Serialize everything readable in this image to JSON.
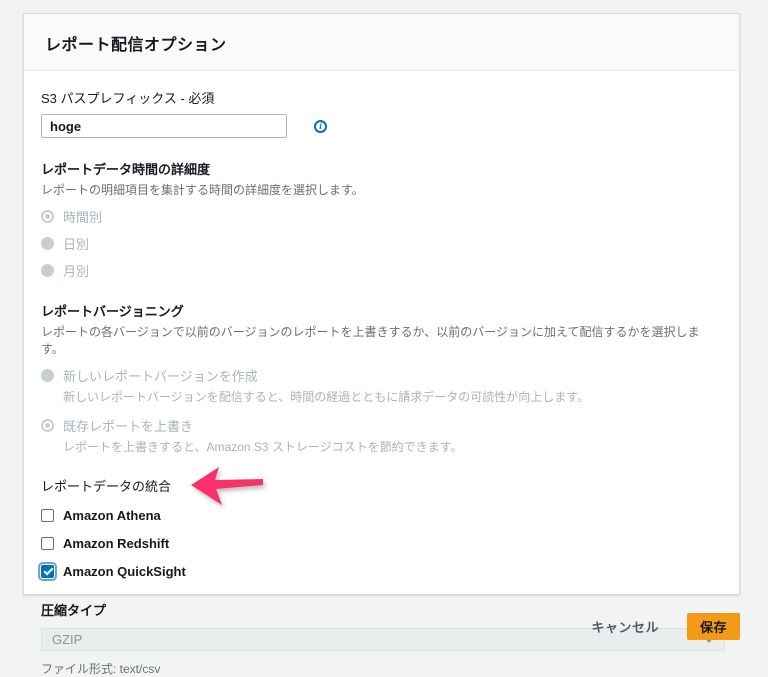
{
  "panel": {
    "title": "レポート配信オプション",
    "s3_prefix": {
      "label": "S3 パスプレフィックス - 必須",
      "value": "hoge",
      "info_icon_glyph": "i"
    },
    "granularity": {
      "label": "レポートデータ時間の詳細度",
      "description": "レポートの明細項目を集計する時間の詳細度を選択します。",
      "options": [
        {
          "label": "時間別",
          "selected": true,
          "disabled": true
        },
        {
          "label": "日別",
          "selected": false,
          "disabled": true
        },
        {
          "label": "月別",
          "selected": false,
          "disabled": true
        }
      ]
    },
    "versioning": {
      "label": "レポートバージョニング",
      "description": "レポートの各バージョンで以前のバージョンのレポートを上書きするか、以前のバージョンに加えて配信するかを選択します。",
      "options": [
        {
          "label": "新しいレポートバージョンを作成",
          "description": "新しいレポートバージョンを配信すると、時間の経過とともに請求データの可読性が向上します。",
          "selected": false,
          "disabled": true
        },
        {
          "label": "既存レポートを上書き",
          "description": "レポートを上書きすると、Amazon S3 ストレージコストを節約できます。",
          "selected": true,
          "disabled": true
        }
      ]
    },
    "integration": {
      "label": "レポートデータの統合",
      "options": [
        {
          "label": "Amazon Athena",
          "checked": false
        },
        {
          "label": "Amazon Redshift",
          "checked": false
        },
        {
          "label": "Amazon QuickSight",
          "checked": true
        }
      ]
    },
    "compression": {
      "label": "圧縮タイプ",
      "value": "GZIP",
      "note": "ファイル形式: text/csv"
    }
  },
  "footer": {
    "cancel_label": "キャンセル",
    "save_label": "保存"
  },
  "annotation": {
    "type": "arrow",
    "direction": "left",
    "points_at": "Amazon QuickSight",
    "color": "#f8316b"
  },
  "colors": {
    "page_background": "#f2f3f3",
    "card_background": "#ffffff",
    "header_background": "#fafafa",
    "accent_blue": "#0073bb",
    "save_button_orange": "#f49a18",
    "disabled_gray": "#c6cfd4",
    "disabled_text": "#a9b4ba",
    "description_text": "#687078"
  }
}
